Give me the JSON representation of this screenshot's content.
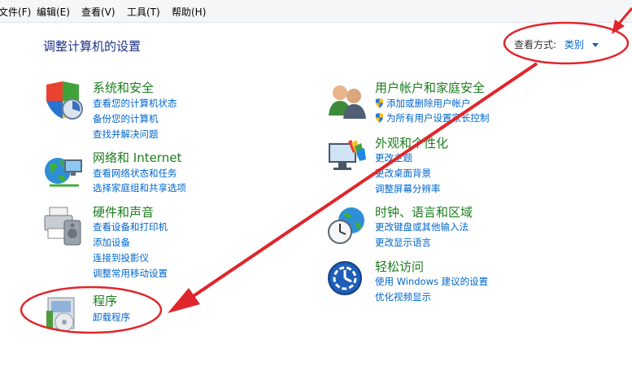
{
  "menubar": {
    "items": [
      "文件(F)",
      "编辑(E)",
      "查看(V)",
      "工具(T)",
      "帮助(H)"
    ]
  },
  "page_title": "调整计算机的设置",
  "view_by": {
    "label": "查看方式:",
    "value": "类别"
  },
  "categories": {
    "system": {
      "title": "系统和安全",
      "links": [
        "查看您的计算机状态",
        "备份您的计算机",
        "查找并解决问题"
      ]
    },
    "network": {
      "title": "网络和 Internet",
      "links": [
        "查看网络状态和任务",
        "选择家庭组和共享选项"
      ]
    },
    "hardware": {
      "title": "硬件和声音",
      "links": [
        "查看设备和打印机",
        "添加设备",
        "连接到投影仪",
        "调整常用移动设置"
      ]
    },
    "programs": {
      "title": "程序",
      "links": [
        "卸载程序"
      ]
    },
    "users": {
      "title": "用户帐户和家庭安全",
      "links": [
        "添加或删除用户帐户",
        "为所有用户设置家长控制"
      ]
    },
    "appearance": {
      "title": "外观和个性化",
      "links": [
        "更改主题",
        "更改桌面背景",
        "调整屏幕分辨率"
      ]
    },
    "clock": {
      "title": "时钟、语言和区域",
      "links": [
        "更改键盘或其他输入法",
        "更改显示语言"
      ]
    },
    "ease": {
      "title": "轻松访问",
      "links": [
        "使用 Windows 建议的设置",
        "优化视频显示"
      ]
    }
  },
  "colors": {
    "category_title": "#1e7c1e",
    "link": "#0066cc",
    "annotation": "#e0262b"
  }
}
